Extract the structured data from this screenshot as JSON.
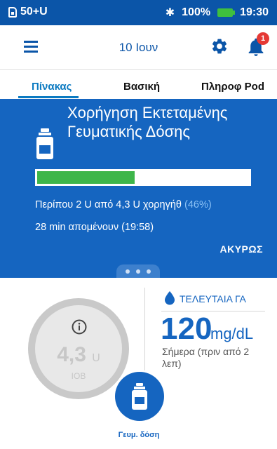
{
  "status_bar": {
    "carrier": "50+U",
    "battery": "100%",
    "time": "19:30"
  },
  "app_bar": {
    "title": "10 Ιουν",
    "notification_count": "1"
  },
  "tabs": [
    {
      "label": "Πίνακας",
      "active": true
    },
    {
      "label": "Βασική",
      "active": false
    },
    {
      "label": "Πληροφ Pod",
      "active": false
    }
  ],
  "bolus_panel": {
    "title": "Χορήγηση Εκτεταμένης Γευματικής Δόσης",
    "progress_fraction": 0.46,
    "delivered_text": "Περίπου 2 U από 4,3 U χορηγήθ",
    "delivered_percent": "(46%)",
    "remaining_text": "28 min απομένουν (19:58)",
    "cancel_label": "ΑΚΥΡΩΣ"
  },
  "iob": {
    "value": "4,3",
    "unit": "U",
    "label": "IOB"
  },
  "blood_glucose": {
    "header": "ΤΕΛΕΥΤΑΙΑ ΓΑ",
    "value": "120",
    "unit": "mg/dL",
    "time_text": "Σήμερα (πριν από 2 λεπ)"
  },
  "bolus_button": {
    "label": "Γευμ. δόση"
  },
  "colors": {
    "primary": "#1565c0",
    "status_bar": "#0b55a8",
    "progress": "#3eb64a",
    "alert": "#e53935"
  }
}
